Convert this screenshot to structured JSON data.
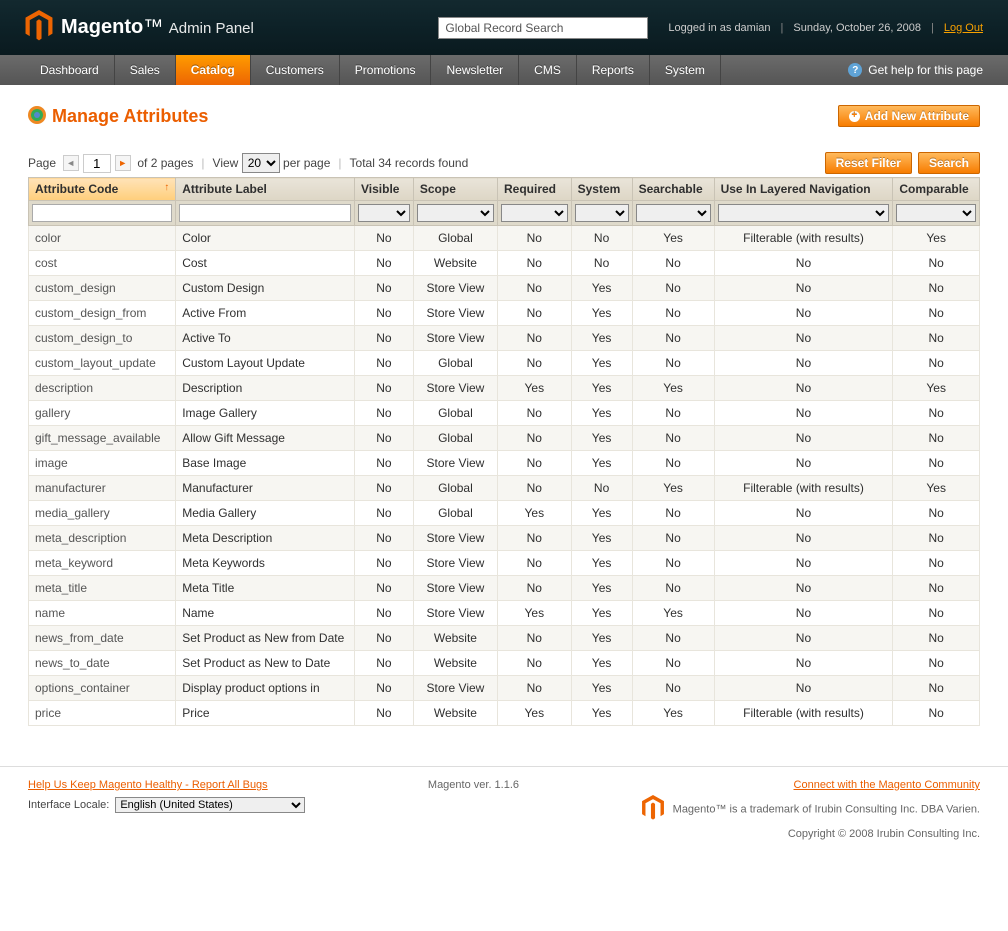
{
  "header": {
    "brand_bold": "Magento",
    "brand_light": "Admin Panel",
    "search_placeholder": "Global Record Search",
    "logged_in": "Logged in as damian",
    "date": "Sunday, October 26, 2008",
    "logout": "Log Out"
  },
  "nav": {
    "items": [
      "Dashboard",
      "Sales",
      "Catalog",
      "Customers",
      "Promotions",
      "Newsletter",
      "CMS",
      "Reports",
      "System"
    ],
    "active_index": 2,
    "help": "Get help for this page"
  },
  "page": {
    "title": "Manage Attributes",
    "add_button": "Add New Attribute"
  },
  "toolbar": {
    "page_label": "Page",
    "page_value": "1",
    "pages_text": "of 2 pages",
    "view_label": "View",
    "perpage_value": "20",
    "perpage_text": "per page",
    "total_text": "Total 34 records found",
    "reset": "Reset Filter",
    "search": "Search"
  },
  "columns": [
    "Attribute Code",
    "Attribute Label",
    "Visible",
    "Scope",
    "Required",
    "System",
    "Searchable",
    "Use In Layered Navigation",
    "Comparable"
  ],
  "rows": [
    {
      "code": "color",
      "label": "Color",
      "visible": "No",
      "scope": "Global",
      "required": "No",
      "system": "No",
      "searchable": "Yes",
      "layered": "Filterable (with results)",
      "comparable": "Yes"
    },
    {
      "code": "cost",
      "label": "Cost",
      "visible": "No",
      "scope": "Website",
      "required": "No",
      "system": "No",
      "searchable": "No",
      "layered": "No",
      "comparable": "No"
    },
    {
      "code": "custom_design",
      "label": "Custom Design",
      "visible": "No",
      "scope": "Store View",
      "required": "No",
      "system": "Yes",
      "searchable": "No",
      "layered": "No",
      "comparable": "No"
    },
    {
      "code": "custom_design_from",
      "label": "Active From",
      "visible": "No",
      "scope": "Store View",
      "required": "No",
      "system": "Yes",
      "searchable": "No",
      "layered": "No",
      "comparable": "No"
    },
    {
      "code": "custom_design_to",
      "label": "Active To",
      "visible": "No",
      "scope": "Store View",
      "required": "No",
      "system": "Yes",
      "searchable": "No",
      "layered": "No",
      "comparable": "No"
    },
    {
      "code": "custom_layout_update",
      "label": "Custom Layout Update",
      "visible": "No",
      "scope": "Global",
      "required": "No",
      "system": "Yes",
      "searchable": "No",
      "layered": "No",
      "comparable": "No"
    },
    {
      "code": "description",
      "label": "Description",
      "visible": "No",
      "scope": "Store View",
      "required": "Yes",
      "system": "Yes",
      "searchable": "Yes",
      "layered": "No",
      "comparable": "Yes"
    },
    {
      "code": "gallery",
      "label": "Image Gallery",
      "visible": "No",
      "scope": "Global",
      "required": "No",
      "system": "Yes",
      "searchable": "No",
      "layered": "No",
      "comparable": "No"
    },
    {
      "code": "gift_message_available",
      "label": "Allow Gift Message",
      "visible": "No",
      "scope": "Global",
      "required": "No",
      "system": "Yes",
      "searchable": "No",
      "layered": "No",
      "comparable": "No"
    },
    {
      "code": "image",
      "label": "Base Image",
      "visible": "No",
      "scope": "Store View",
      "required": "No",
      "system": "Yes",
      "searchable": "No",
      "layered": "No",
      "comparable": "No"
    },
    {
      "code": "manufacturer",
      "label": "Manufacturer",
      "visible": "No",
      "scope": "Global",
      "required": "No",
      "system": "No",
      "searchable": "Yes",
      "layered": "Filterable (with results)",
      "comparable": "Yes"
    },
    {
      "code": "media_gallery",
      "label": "Media Gallery",
      "visible": "No",
      "scope": "Global",
      "required": "Yes",
      "system": "Yes",
      "searchable": "No",
      "layered": "No",
      "comparable": "No"
    },
    {
      "code": "meta_description",
      "label": "Meta Description",
      "visible": "No",
      "scope": "Store View",
      "required": "No",
      "system": "Yes",
      "searchable": "No",
      "layered": "No",
      "comparable": "No"
    },
    {
      "code": "meta_keyword",
      "label": "Meta Keywords",
      "visible": "No",
      "scope": "Store View",
      "required": "No",
      "system": "Yes",
      "searchable": "No",
      "layered": "No",
      "comparable": "No"
    },
    {
      "code": "meta_title",
      "label": "Meta Title",
      "visible": "No",
      "scope": "Store View",
      "required": "No",
      "system": "Yes",
      "searchable": "No",
      "layered": "No",
      "comparable": "No"
    },
    {
      "code": "name",
      "label": "Name",
      "visible": "No",
      "scope": "Store View",
      "required": "Yes",
      "system": "Yes",
      "searchable": "Yes",
      "layered": "No",
      "comparable": "No"
    },
    {
      "code": "news_from_date",
      "label": "Set Product as New from Date",
      "visible": "No",
      "scope": "Website",
      "required": "No",
      "system": "Yes",
      "searchable": "No",
      "layered": "No",
      "comparable": "No"
    },
    {
      "code": "news_to_date",
      "label": "Set Product as New to Date",
      "visible": "No",
      "scope": "Website",
      "required": "No",
      "system": "Yes",
      "searchable": "No",
      "layered": "No",
      "comparable": "No"
    },
    {
      "code": "options_container",
      "label": "Display product options in",
      "visible": "No",
      "scope": "Store View",
      "required": "No",
      "system": "Yes",
      "searchable": "No",
      "layered": "No",
      "comparable": "No"
    },
    {
      "code": "price",
      "label": "Price",
      "visible": "No",
      "scope": "Website",
      "required": "Yes",
      "system": "Yes",
      "searchable": "Yes",
      "layered": "Filterable (with results)",
      "comparable": "No"
    }
  ],
  "footer": {
    "bugs": "Help Us Keep Magento Healthy - Report All Bugs",
    "locale_label": "Interface Locale:",
    "locale_value": "English (United States)",
    "version": "Magento ver. 1.1.6",
    "community": "Connect with the Magento Community",
    "trademark": "Magento™ is a trademark of Irubin Consulting Inc. DBA Varien.",
    "copyright": "Copyright © 2008 Irubin Consulting Inc."
  }
}
